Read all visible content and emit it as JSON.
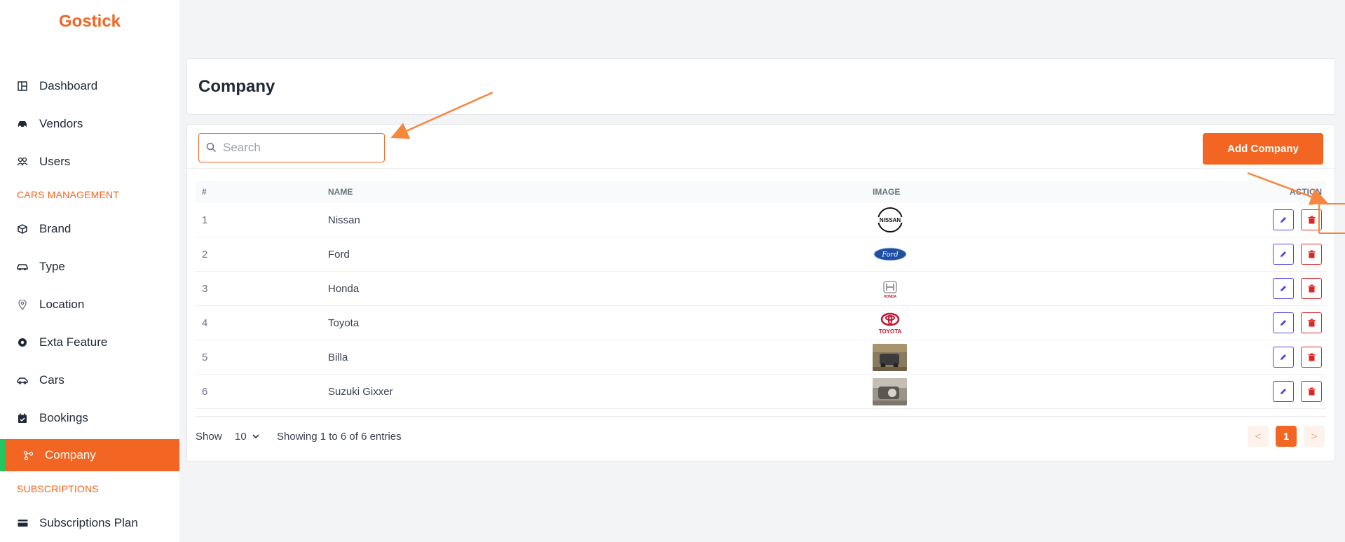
{
  "app": {
    "logo": "Gostick"
  },
  "sidebar": {
    "items": [
      {
        "label": "Dashboard",
        "icon": "dashboard-icon"
      },
      {
        "label": "Vendors",
        "icon": "car-icon"
      },
      {
        "label": "Users",
        "icon": "users-icon"
      }
    ],
    "section_cars": "CARS MANAGEMENT",
    "cars_items": [
      {
        "label": "Brand",
        "icon": "cube-icon"
      },
      {
        "label": "Type",
        "icon": "car-type-icon"
      },
      {
        "label": "Location",
        "icon": "location-pin-icon"
      },
      {
        "label": "Exta Feature",
        "icon": "feature-icon"
      },
      {
        "label": "Cars",
        "icon": "car-icon"
      },
      {
        "label": "Bookings",
        "icon": "calendar-check-icon"
      },
      {
        "label": "Company",
        "icon": "company-icon",
        "active": true
      }
    ],
    "section_subs": "SUBSCRIPTIONS",
    "subs_items": [
      {
        "label": "Subscriptions Plan",
        "icon": "credit-card-icon"
      }
    ]
  },
  "header": {
    "title": "Company"
  },
  "toolbar": {
    "search_placeholder": "Search",
    "search_value": "",
    "add_label": "Add Company"
  },
  "table": {
    "columns": [
      "#",
      "NAME",
      "IMAGE",
      "ACTION"
    ],
    "rows": [
      {
        "num": "1",
        "name": "Nissan",
        "logo": "nissan-logo"
      },
      {
        "num": "2",
        "name": "Ford",
        "logo": "ford-logo"
      },
      {
        "num": "3",
        "name": "Honda",
        "logo": "honda-logo"
      },
      {
        "num": "4",
        "name": "Toyota",
        "logo": "toyota-logo"
      },
      {
        "num": "5",
        "name": "Billa",
        "logo": "photo-thumbnail"
      },
      {
        "num": "6",
        "name": "Suzuki Gixxer",
        "logo": "photo-thumbnail"
      }
    ]
  },
  "footer": {
    "show_label": "Show",
    "page_size": "10",
    "entries_info": "Showing 1 to 6 of 6 entries",
    "prev": "<",
    "current_page": "1",
    "next": ">"
  },
  "colors": {
    "accent": "#f26522",
    "active_marker": "#22c55e",
    "edit": "#4f46e5",
    "delete": "#dc2626"
  }
}
